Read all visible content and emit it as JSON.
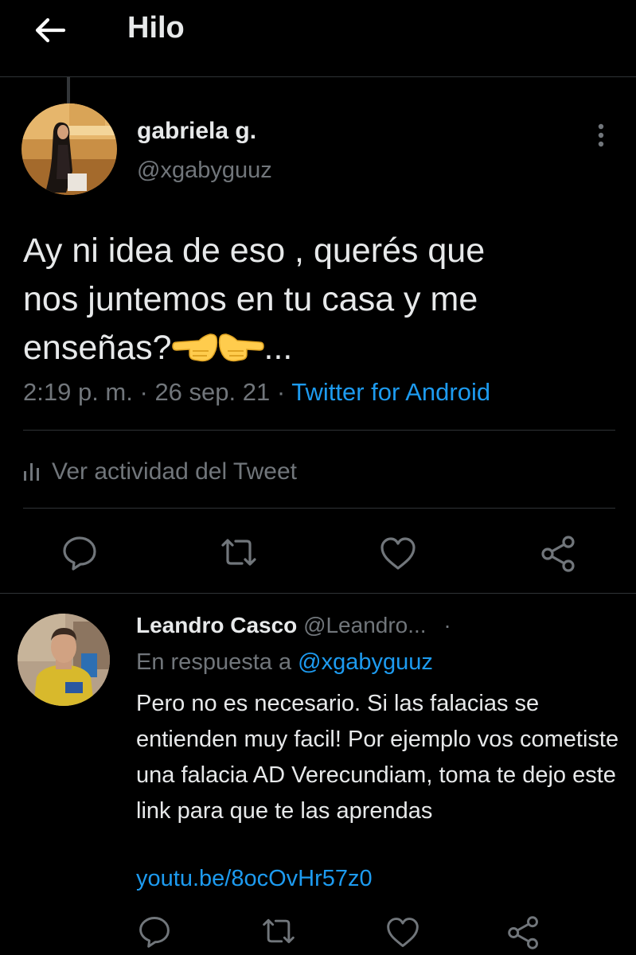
{
  "header": {
    "title": "Hilo",
    "back_icon": "arrow-left-icon"
  },
  "main_tweet": {
    "author_name": "gabriela g.",
    "author_handle": "@xgabyguuz",
    "text_line1": "Ay ni idea de eso , querés que",
    "text_line2": "nos juntemos en tu casa y me",
    "text_line3_start": "enseñas?",
    "emoji_1": "backhand-index-pointing-left",
    "emoji_2": "backhand-index-pointing-right",
    "text_line3_end": "...",
    "time": "2:19 p. m.",
    "date": "26 sep. 21",
    "meta_sep": "·",
    "source": "Twitter for Android",
    "activity_label": "Ver actividad del Tweet",
    "actions": [
      "reply-icon",
      "retweet-icon",
      "like-icon",
      "share-icon"
    ]
  },
  "reply": {
    "author_name": "Leandro Casco",
    "author_handle": "@Leandro...",
    "dot": "·",
    "reply_to_label": "En respuesta a",
    "reply_to_handle": "@xgabyguuz",
    "text": "Pero no es necesario. Si las falacias se entienden muy facil! Por ejemplo vos cometiste una falacia AD Verecundiam, toma te dejo este link para que te las aprendas",
    "link": "youtu.be/8ocOvHr57z0",
    "actions": [
      "reply-icon",
      "retweet-icon",
      "like-icon",
      "share-icon"
    ]
  },
  "colors": {
    "background": "#000000",
    "text_primary": "#e7e9ea",
    "text_secondary": "#71767b",
    "accent": "#1d9bf0",
    "divider": "#2f3336"
  }
}
